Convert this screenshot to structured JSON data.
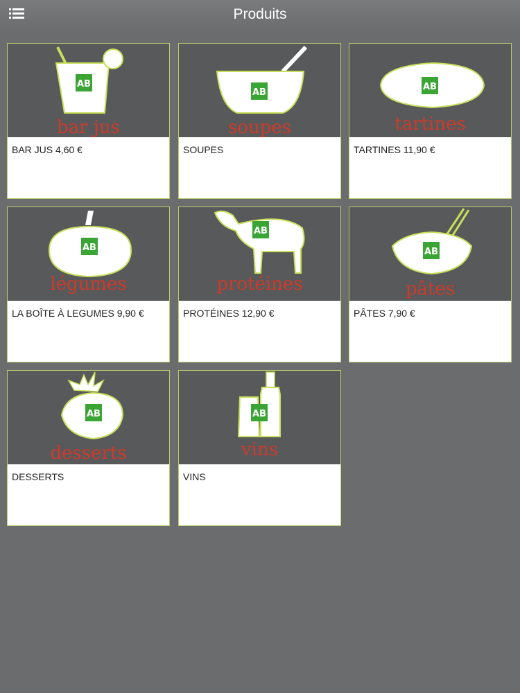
{
  "header": {
    "title": "Produits"
  },
  "products": [
    {
      "tag": "bar jus",
      "label": "BAR JUS 4,60 €",
      "icon": "juice-glass-icon"
    },
    {
      "tag": "soupes",
      "label": "SOUPES",
      "icon": "soup-bowl-icon"
    },
    {
      "tag": "tartines",
      "label": "TARTINES 11,90 €",
      "icon": "bread-icon"
    },
    {
      "tag": "légumes",
      "label": "LA BOÎTE À LEGUMES 9,90 €",
      "icon": "pumpkin-icon"
    },
    {
      "tag": "protéines",
      "label": "PROTÉINES 12,90 €",
      "icon": "sheep-icon"
    },
    {
      "tag": "pâtes",
      "label": "PÂTES 7,90 €",
      "icon": "pasta-bowl-icon"
    },
    {
      "tag": "desserts",
      "label": "DESSERTS",
      "icon": "strawberry-icon"
    },
    {
      "tag": "vins",
      "label": "VINS",
      "icon": "wine-bottle-icon"
    }
  ],
  "badge": {
    "text": "AB"
  },
  "colors": {
    "background": "#6b6c6e",
    "card_image_bg": "#58595b",
    "tag": "#cf3a2a",
    "border": "#b9cf6f",
    "badge": "#3aa535"
  }
}
